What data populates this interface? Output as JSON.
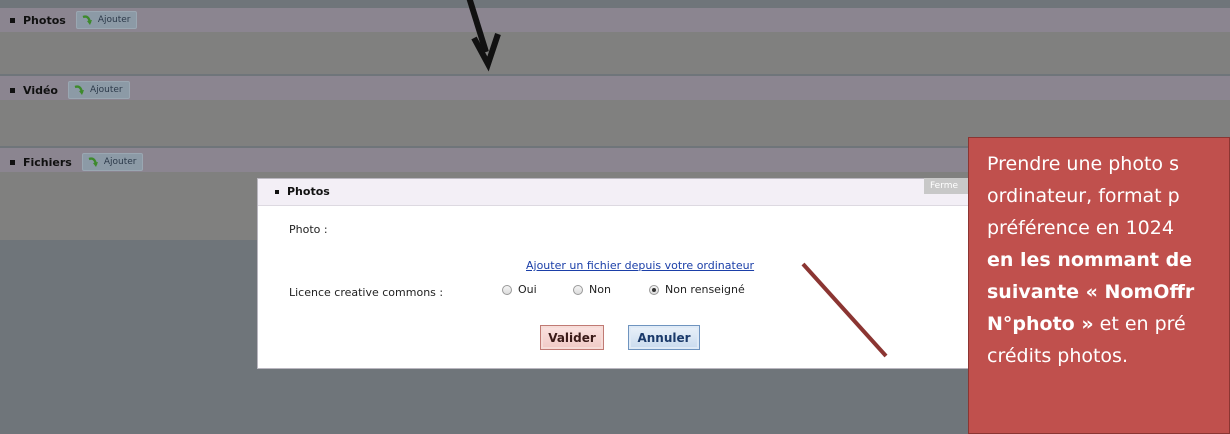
{
  "sections": [
    {
      "title": "Photos",
      "add_label": "Ajouter"
    },
    {
      "title": "Vidéo",
      "add_label": "Ajouter"
    },
    {
      "title": "Fichiers",
      "add_label": "Ajouter"
    }
  ],
  "modal": {
    "title": "Photos",
    "close_label": "Ferme",
    "photo_label": "Photo :",
    "add_file_link": "Ajouter un fichier depuis votre ordinateur",
    "license_label": "Licence creative commons :",
    "license_options": [
      "Oui",
      "Non",
      "Non renseigné"
    ],
    "license_selected": "Non renseigné",
    "validate_label": "Valider",
    "cancel_label": "Annuler"
  },
  "annotation": {
    "lines": [
      {
        "plain": "Prendre une photo s",
        "bold": ""
      },
      {
        "plain": "ordinateur, format p",
        "bold": ""
      },
      {
        "plain": "préférence en 1024",
        "bold": ""
      },
      {
        "plain": "",
        "bold": "en les nommant de"
      },
      {
        "plain": "",
        "bold": "suivante « NomOffr"
      },
      {
        "plain": " et en pré",
        "bold": "N°photo »"
      },
      {
        "plain": "crédits photos.",
        "bold": ""
      }
    ]
  },
  "colors": {
    "annotation_bg": "#c0504d",
    "link": "#1b3fa8",
    "pointer_line": "#8b3532"
  }
}
